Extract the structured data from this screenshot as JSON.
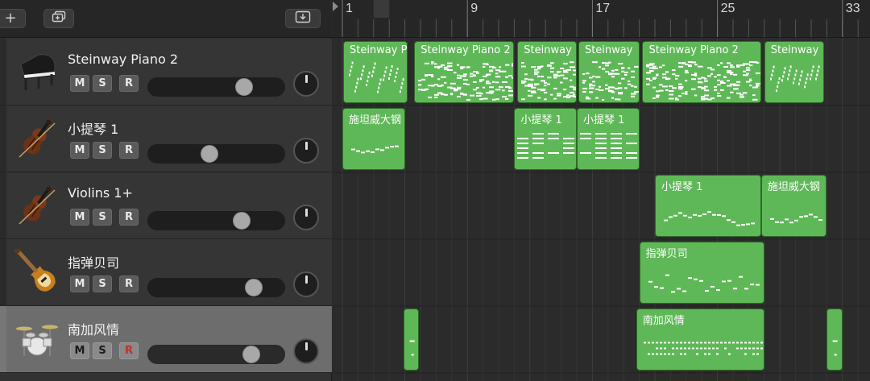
{
  "toolbar": {
    "add_label": "+",
    "add_track_icon": "duplicate-icon",
    "download_icon": "download-icon"
  },
  "ruler": {
    "marks": [
      "1",
      "9",
      "17",
      "25",
      "33"
    ]
  },
  "tracks": [
    {
      "name": "Steinway Piano 2",
      "icon": "grand-piano-icon",
      "m": "M",
      "s": "S",
      "r": "R",
      "volume": 0.74
    },
    {
      "name": "小提琴 1",
      "icon": "violin-icon",
      "m": "M",
      "s": "S",
      "r": "R",
      "volume": 0.44
    },
    {
      "name": "Violins 1+",
      "icon": "violin-icon",
      "m": "M",
      "s": "S",
      "r": "R",
      "volume": 0.72
    },
    {
      "name": "指弹贝司",
      "icon": "bass-guitar-icon",
      "m": "M",
      "s": "S",
      "r": "R",
      "volume": 0.82
    },
    {
      "name": "南加风情",
      "icon": "drum-kit-icon",
      "m": "M",
      "s": "S",
      "r": "R",
      "volume": 0.8
    }
  ],
  "regions": [
    {
      "track": 0,
      "name": "Steinway P",
      "start": 1.05,
      "end": 5.2,
      "style": "diag"
    },
    {
      "track": 0,
      "name": "Steinway Piano 2",
      "start": 5.6,
      "end": 12.0,
      "style": "dense"
    },
    {
      "track": 0,
      "name": "Steinway",
      "start": 12.2,
      "end": 16.0,
      "style": "dense"
    },
    {
      "track": 0,
      "name": "Steinway",
      "start": 16.1,
      "end": 20.0,
      "style": "dense"
    },
    {
      "track": 0,
      "name": "Steinway Piano 2",
      "start": 20.2,
      "end": 27.8,
      "style": "dense"
    },
    {
      "track": 0,
      "name": "Steinway",
      "start": 28.0,
      "end": 31.8,
      "style": "diag"
    },
    {
      "track": 1,
      "name": "施坦威大钢",
      "start": 1.0,
      "end": 5.0,
      "style": "melody"
    },
    {
      "track": 1,
      "name": "小提琴 1",
      "start": 12.0,
      "end": 16.0,
      "style": "chord"
    },
    {
      "track": 1,
      "name": "小提琴 1",
      "start": 16.0,
      "end": 20.0,
      "style": "chord"
    },
    {
      "track": 2,
      "name": "小提琴 1",
      "start": 21.0,
      "end": 27.8,
      "style": "melody"
    },
    {
      "track": 2,
      "name": "施坦威大钢",
      "start": 27.8,
      "end": 32.0,
      "style": "melody"
    },
    {
      "track": 3,
      "name": "指弹贝司",
      "start": 20.0,
      "end": 28.0,
      "style": "bass"
    },
    {
      "track": 4,
      "name": "",
      "start": 4.9,
      "end": 5.9,
      "style": "sparse"
    },
    {
      "track": 4,
      "name": "南加风情",
      "start": 19.8,
      "end": 28.0,
      "style": "drums"
    },
    {
      "track": 4,
      "name": "",
      "start": 32.0,
      "end": 33.0,
      "style": "sparse"
    }
  ]
}
